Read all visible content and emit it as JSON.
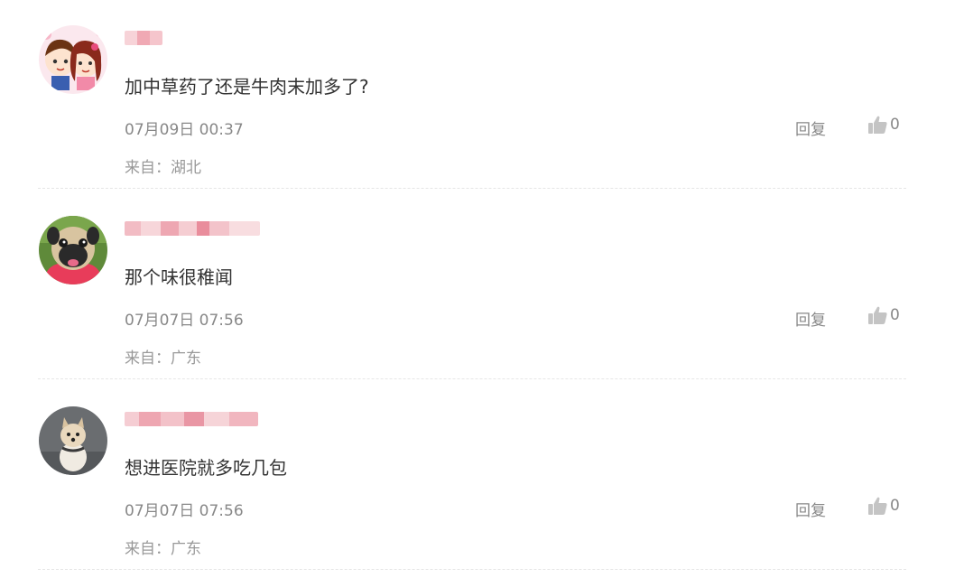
{
  "comments": [
    {
      "avatar": "cartoon-couple-avatar",
      "content": "加中草药了还是牛肉末加多了?",
      "time": "07月09日 00:37",
      "reply_label": "回复",
      "like_count": "0",
      "location": "来自：湖北"
    },
    {
      "avatar": "pug-dog-avatar",
      "content": "那个味很稚闻",
      "time": "07月07日 07:56",
      "reply_label": "回复",
      "like_count": "0",
      "location": "来自：广东"
    },
    {
      "avatar": "pomeranian-dog-avatar",
      "content": "想进医院就多吃几包",
      "time": "07月07日 07:56",
      "reply_label": "回复",
      "like_count": "0",
      "location": "来自：广东"
    }
  ],
  "colors": {
    "content_text": "#333333",
    "meta_text": "#888888",
    "like_icon": "#c4c4c4",
    "username_blur": "#f0b8c0",
    "divider": "#e6e6e6"
  }
}
